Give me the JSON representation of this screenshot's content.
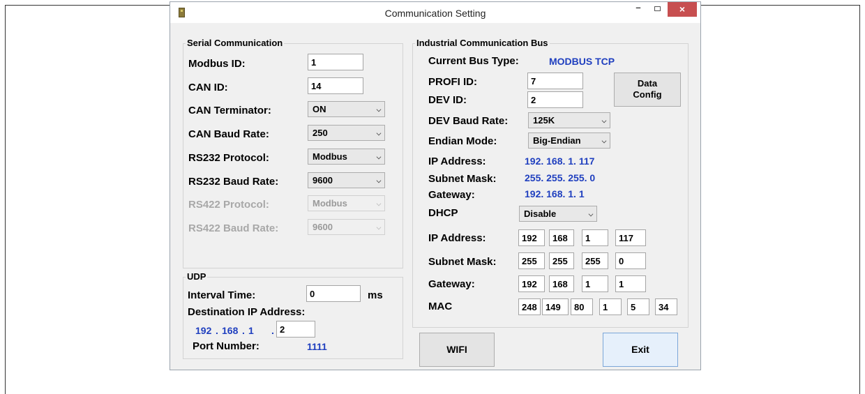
{
  "window": {
    "title": "Communication Setting",
    "min_glyph": "–",
    "close_glyph": "×"
  },
  "serial": {
    "group_title": "Serial Communication",
    "modbus_id": {
      "label": "Modbus ID:",
      "value": "1"
    },
    "can_id": {
      "label": "CAN ID:",
      "value": "14"
    },
    "can_terminator": {
      "label": "CAN Terminator:",
      "value": "ON"
    },
    "can_baud": {
      "label": "CAN Baud Rate:",
      "value": "250"
    },
    "rs232_protocol": {
      "label": "RS232 Protocol:",
      "value": "Modbus"
    },
    "rs232_baud": {
      "label": "RS232 Baud Rate:",
      "value": "9600"
    },
    "rs422_protocol": {
      "label": "RS422 Protocol:",
      "value": "Modbus"
    },
    "rs422_baud": {
      "label": "RS422 Baud Rate:",
      "value": "9600"
    }
  },
  "udp": {
    "group_title": "UDP",
    "interval_label": "Interval Time:",
    "interval_value": "0",
    "interval_unit": "ms",
    "dest_label": "Destination IP Address:",
    "dest_ip": [
      "192",
      "168",
      "1",
      "2"
    ],
    "dot": ".",
    "port_label": "Port Number:",
    "port_value": "1111"
  },
  "bus": {
    "group_title": "Industrial Communication Bus",
    "current_type_label": "Current Bus Type:",
    "current_type_value": "MODBUS TCP",
    "profi_id": {
      "label": "PROFI ID:",
      "value": "7"
    },
    "dev_id": {
      "label": "DEV ID:",
      "value": "2"
    },
    "data_config": {
      "line1": "Data",
      "line2": "Config"
    },
    "dev_baud": {
      "label": "DEV Baud Rate:",
      "value": "125K"
    },
    "endian": {
      "label": "Endian Mode:",
      "value": "Big-Endian"
    },
    "ip_display": {
      "label": "IP Address:",
      "value": "192. 168. 1. 117"
    },
    "mask_display": {
      "label": "Subnet Mask:",
      "value": "255. 255. 255. 0"
    },
    "gateway_display": {
      "label": "Gateway:",
      "value": "192. 168. 1. 1"
    },
    "dhcp": {
      "label": "DHCP",
      "value": "Disable"
    },
    "ip_edit": {
      "label": "IP Address:",
      "octets": [
        "192",
        "168",
        "1",
        "117"
      ]
    },
    "mask_edit": {
      "label": "Subnet Mask:",
      "octets": [
        "255",
        "255",
        "255",
        "0"
      ]
    },
    "gateway_edit": {
      "label": "Gateway:",
      "octets": [
        "192",
        "168",
        "1",
        "1"
      ]
    },
    "mac": {
      "label": "MAC",
      "octets": [
        "248",
        "149",
        "80",
        "1",
        "5",
        "34"
      ]
    }
  },
  "buttons": {
    "wifi": "WIFI",
    "exit": "Exit"
  }
}
